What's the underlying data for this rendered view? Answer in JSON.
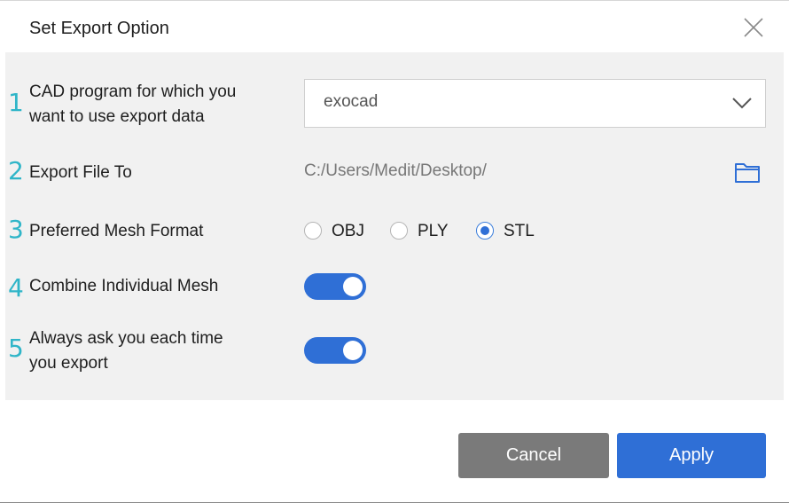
{
  "dialog": {
    "title": "Set Export Option",
    "close_icon": "close-icon"
  },
  "options": {
    "cad_program": {
      "number": "1",
      "label_line1": "CAD program for which you",
      "label_line2": "want to use export data",
      "selected_value": "exocad",
      "icon": "chevron-down-icon"
    },
    "export_file_to": {
      "number": "2",
      "label": "Export File To",
      "path": "C:/Users/Medit/Desktop/",
      "icon": "folder-icon"
    },
    "mesh_format": {
      "number": "3",
      "label": "Preferred Mesh Format",
      "choices": [
        "OBJ",
        "PLY",
        "STL"
      ],
      "selected": "STL"
    },
    "combine_mesh": {
      "number": "4",
      "label": "Combine Individual Mesh",
      "enabled": true
    },
    "always_ask": {
      "number": "5",
      "label_line1": "Always ask you each time",
      "label_line2": "you export",
      "enabled": true
    }
  },
  "buttons": {
    "cancel": "Cancel",
    "apply": "Apply"
  },
  "colors": {
    "accent": "#2f6fd6",
    "number_color": "#2fb5c8",
    "cancel_bg": "#7a7a7a",
    "panel_bg": "#f1f1f1"
  }
}
